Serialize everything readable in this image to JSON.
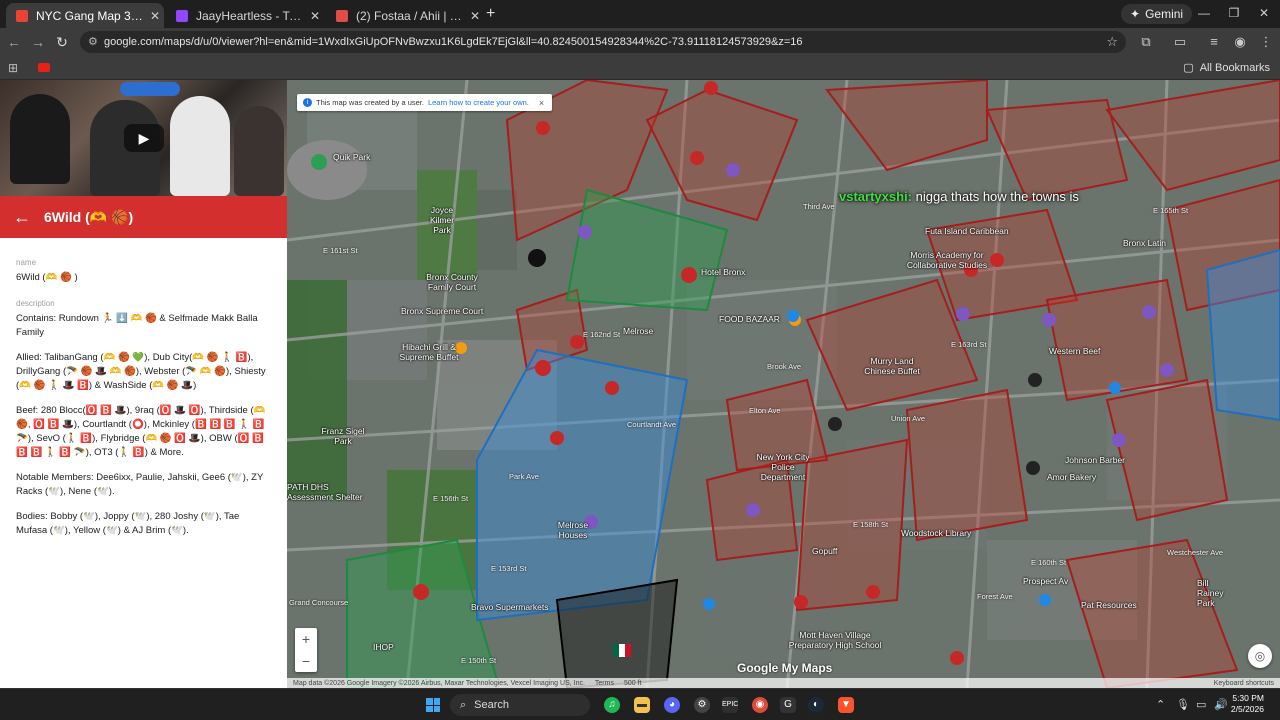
{
  "browser": {
    "tabs": [
      {
        "title": "NYC Gang Map 3.0 - Google M",
        "favicon_color": "#ea4335"
      },
      {
        "title": "JaayHeartless - Twitch",
        "favicon_color": "#9146ff"
      },
      {
        "title": "(2) Fostaa / Ahii | The Towns Ro",
        "favicon_color": "#e04c4c"
      }
    ],
    "gemini_label": "Gemini",
    "url": "google.com/maps/d/u/0/viewer?hl=en&mid=1WxdIxGiUpOFNvBwzxu1K6LgdEk7EjGl&ll=40.82450015492834​4%2C-73.91118124573929&z=16",
    "all_bookmarks_label": "All Bookmarks"
  },
  "sidebar": {
    "header_title": "6Wild (🫶 🏀)",
    "name_label": "name",
    "name_value": "6Wild (🫶 🏀 )",
    "description_label": "description",
    "contains": "Contains: Rundown 🏃 ⬇️ 🫶 🏀  & Selfmade Makk Balla Family",
    "allied": "Allied: TalibanGang (🫶 🏀 💚), Dub City(🫶 🏀 🚶 🅱️), DrillyGang (🪂 🏀 🎩 🫶 🏀), Webster (🪂 🫶 🏀), Shiesty (🫶 🏀 🚶 🎩 🅱️) & WashSide (🫶 🏀 🎩)",
    "beef": "Beef: 280 Blocc(🅾️ 🅱️ 🎩), 9raq (🅾️ 🎩 🅾️), Thirdside (🫶 🏀, 🅾️ 🅱️ 🎩), Courtlandt (⭕), Mckinley (🅱️ 🅱️ 🅱️ 🚶 🅱️ 🪂), SevO (🚶 🅱️), Flybridge (🫶 🏀 🅾️ 🎩), OBW (🅾️ 🅱️ 🅱️ 🅱️ 🚶 🅱️ 🪂), OT3 (🚶 🅱️) & More.",
    "notable": "Notable Members: Dee6ixx, Paulie, Jahskii, Gee6 (🕊️), ZY Racks (🕊️), Nene (🕊️).",
    "bodies": "Bodies: Bobby (🕊️), Joppy (🕊️), 280 Joshy (🕊️), Tae Mufasa (🕊️), Yellow (🕊️) & AJ Brim (🕊️)."
  },
  "map": {
    "notice_text": "This map was created by a user.",
    "notice_link": "Learn how to create your own.",
    "chat_user": "vstartyxshi:",
    "chat_message": "nigga thats how the towns is",
    "place_labels": [
      "Quik Park",
      "Joyce Kilmer Park",
      "Bronx County Family Court",
      "Bronx Supreme Court",
      "Hibachi Grill & Supreme Buffet",
      "Franz Sigel Park",
      "PATH DHS Assessment Shelter",
      "Hotel Bronx",
      "Melrose",
      "FOOD BAZAAR",
      "Futa Island Caribbean",
      "Morris Academy for Collaborative Studies",
      "Murry Land Chinese Buffet",
      "Western Beef",
      "New York City Police Department",
      "Woodstock Library",
      "Amor Bakery",
      "Bravo Supermarkets",
      "Mott Haven Village Preparatory High School",
      "Prospect Av",
      "Bill Rainey Park",
      "Melrose Houses",
      "Bronx Latin",
      "Johnson Barber",
      "Gopuff",
      "IHOP",
      "Pat Resources"
    ],
    "street_labels": [
      "E 161st St",
      "E 162nd St",
      "E 163rd St",
      "E 158th St",
      "E 156th St",
      "E 153rd St",
      "E 150th St",
      "Grand Concourse",
      "Park Ave",
      "Courtlandt Ave",
      "Elton Ave",
      "Brook Ave",
      "E 160th St",
      "Westchester Ave",
      "Forest Ave",
      "Union Ave",
      "E 165th St",
      "Third Ave"
    ],
    "google_logo": "Google My Maps",
    "attribution": "Map data ©2026 Google Imagery ©2026 Airbus, Maxar Technologies, Vexcel Imaging US, Inc.",
    "terms": "Terms",
    "scale": "500 ft",
    "shortcuts": "Keyboard shortcuts",
    "region_colors": {
      "red": "#c0392b",
      "green": "#2e9e52",
      "blue": "#3a8dde",
      "black": "#111111"
    }
  },
  "taskbar": {
    "search_label": "Search",
    "time": "5:30 PM",
    "date": "2/5/2026"
  }
}
